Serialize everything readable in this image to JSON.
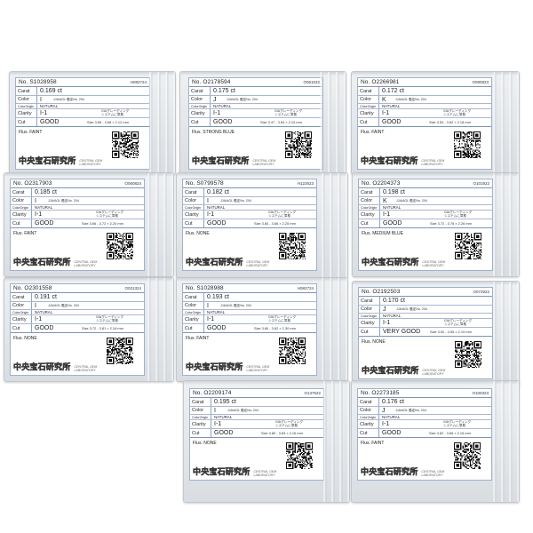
{
  "labels": {
    "no_prefix": "No.",
    "carat": "Carat",
    "color": "Color",
    "color_origin": "ColorOrigin",
    "natural": "NATURAL",
    "clarity": "Clarity",
    "cut": "Cut",
    "jja": "JJA/AGL 鑑定No. 204",
    "gia_line1": "GIAグレーディング",
    "gia_line2": "システムに準拠",
    "flus": "Flus.",
    "logo_jp": "中央宝石研究所",
    "logo_en_line1": "CENTRAL GEM",
    "logo_en_line2": "LABORATORY"
  },
  "cards": [
    {
      "no": "S1028958",
      "code": "H082724",
      "carat": "0.169 ct",
      "color": "I",
      "clarity": "I-1",
      "cut": "GOOD",
      "size": "Size 3.65 - 3.68 × 2.12 mm",
      "flus": "FAINT"
    },
    {
      "no": "O2178594",
      "code": "O061022",
      "carat": "0.175 ct",
      "color": "J",
      "clarity": "I-1",
      "cut": "GOOD",
      "size": "Size 3.47 - 3.54 × 2.24 mm",
      "flus": "STRONG BLUE"
    },
    {
      "no": "O2266981",
      "code": "O090823",
      "carat": "0.172 ct",
      "color": "K",
      "clarity": "I-1",
      "cut": "GOOD",
      "size": "Size 3.53 - 3.62 × 2.18 mm",
      "flus": "FAINT"
    },
    {
      "no": "O2317903",
      "code": "O060824",
      "carat": "0.185 ct",
      "color": "I",
      "clarity": "I-1",
      "cut": "GOOD",
      "size": "Size 3.66 - 3.72 × 2.20 mm",
      "flus": "FAINT"
    },
    {
      "no": "S0799578",
      "code": "H122623",
      "carat": "0.182 ct",
      "color": "I",
      "clarity": "I-1",
      "cut": "GOOD",
      "size": "Size 3.60 - 3.66 × 2.25 mm",
      "flus": "NONE"
    },
    {
      "no": "O2204373",
      "code": "O101922",
      "carat": "0.198 ct",
      "color": "K",
      "clarity": "I-1",
      "cut": "GOOD",
      "size": "Size 3.72 - 3.76 × 2.26 mm",
      "flus": "MEDIUM BLUE"
    },
    {
      "no": "O2301558",
      "code": "O031324",
      "carat": "0.191 ct",
      "color": "I",
      "clarity": "I-1",
      "cut": "GOOD",
      "size": "Size 3.72 - 3.81 × 2.16 mm",
      "flus": "NONE"
    },
    {
      "no": "S1028988",
      "code": "H082724",
      "carat": "0.193 ct",
      "color": "I",
      "clarity": "I-1",
      "cut": "GOOD",
      "size": "Size 3.60 - 3.62 × 2.30 mm",
      "flus": "FAINT"
    },
    {
      "no": "O2192503",
      "code": "O072922",
      "carat": "0.170 ct",
      "color": "J",
      "clarity": "I-1",
      "cut": "VERY GOOD",
      "size": "Size 3.52 - 3.55 × 2.19 mm",
      "flus": "NONE"
    },
    {
      "no": "O2209174",
      "code": "O137522",
      "carat": "0.195 ct",
      "color": "I",
      "clarity": "I-1",
      "cut": "GOOD",
      "size": "Size 3.80 - 3.83 × 2.16 mm",
      "flus": "NONE"
    },
    {
      "no": "O2273185",
      "code": "O100323",
      "carat": "0.176 ct",
      "color": "J",
      "clarity": "I-1",
      "cut": "GOOD",
      "size": "Size 3.62 - 3.66 × 2.16 mm",
      "flus": "FAINT"
    }
  ]
}
